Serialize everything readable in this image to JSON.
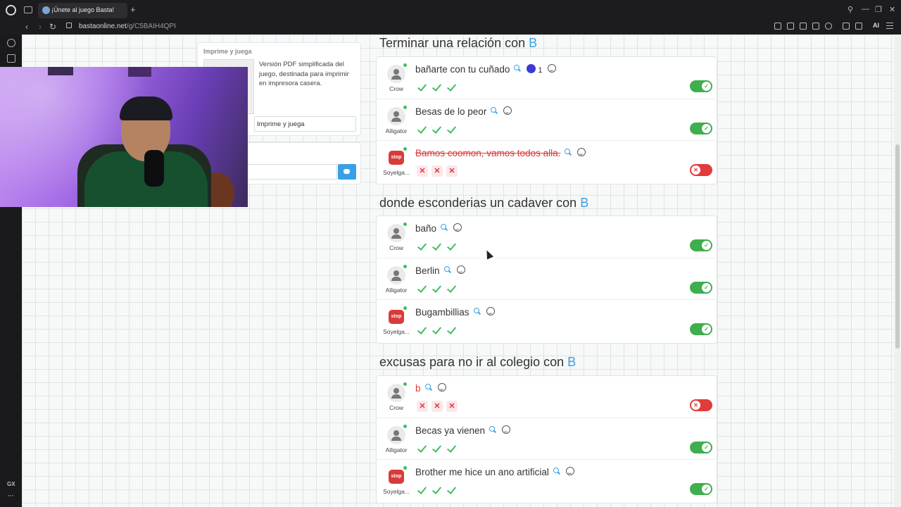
{
  "browser": {
    "tab_title": "¡Únete al juego Basta!",
    "new_tab_symbol": "+",
    "url_domain": "bastaonline.net",
    "url_path": "/g/C5BAIH4QPI",
    "ai_label": "AI",
    "sidebar_gx": "GX",
    "sidebar_more": "···"
  },
  "side_panel": {
    "print_title": "Imprime y juega",
    "print_desc": "Versión PDF simplificada del juego, destinada para imprimir en impresora casera.",
    "print_button": "Imprime y juega"
  },
  "sections": [
    {
      "title": "Terminar una relación con ",
      "letter": "B",
      "rows": [
        {
          "player": "Crow",
          "avatar": "person",
          "answer": "bañarte con tu cuñado",
          "likes": "1",
          "valid": true,
          "votes": [
            "check",
            "check",
            "check"
          ]
        },
        {
          "player": "Alligator",
          "avatar": "person",
          "answer": "Besas de lo peor",
          "valid": true,
          "votes": [
            "check",
            "check",
            "check"
          ]
        },
        {
          "player": "Soyelga...",
          "avatar": "stop",
          "answer": "Bamos coomon, vamos todos alla.",
          "valid": false,
          "votes": [
            "cross",
            "cross",
            "cross"
          ]
        }
      ]
    },
    {
      "title": "donde esconderias un cadaver con ",
      "letter": "B",
      "rows": [
        {
          "player": "Crow",
          "avatar": "person",
          "answer": "baño",
          "valid": true,
          "votes": [
            "check",
            "check",
            "check"
          ]
        },
        {
          "player": "Alligator",
          "avatar": "person",
          "answer": "Berlin",
          "valid": true,
          "votes": [
            "check",
            "check",
            "check"
          ]
        },
        {
          "player": "Soyelga...",
          "avatar": "stop",
          "answer": "Bugambillias",
          "valid": true,
          "votes": [
            "check",
            "check",
            "check"
          ]
        }
      ]
    },
    {
      "title": "excusas para no ir al colegio con ",
      "letter": "B",
      "rows": [
        {
          "player": "Crow",
          "avatar": "person",
          "answer": "b",
          "valid": false,
          "votes": [
            "cross",
            "cross",
            "cross"
          ]
        },
        {
          "player": "Alligator",
          "avatar": "person",
          "answer": "Becas ya vienen",
          "valid": true,
          "votes": [
            "check",
            "check",
            "check"
          ]
        },
        {
          "player": "Soyelga...",
          "avatar": "stop",
          "answer": "Brother me hice un ano artificial",
          "valid": true,
          "votes": [
            "check",
            "check",
            "check"
          ]
        }
      ]
    }
  ],
  "stop_badge": "stop",
  "colors": {
    "accent": "#3aa0e6",
    "valid": "#3fae4e",
    "invalid": "#e23b3b"
  }
}
